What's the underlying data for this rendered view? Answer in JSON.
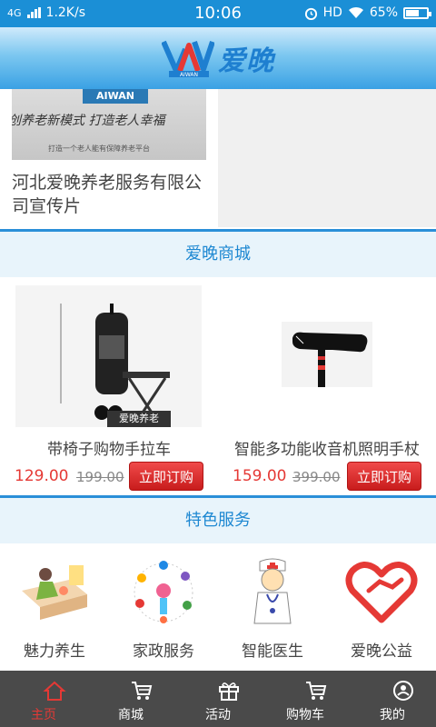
{
  "status_bar": {
    "network": "4G",
    "speed": "1.2K/s",
    "time": "10:06",
    "hd": "HD",
    "battery_percent": "65%",
    "battery_level": 0.65
  },
  "header": {
    "logo_sub": "AIWAN",
    "brand": "爱晚"
  },
  "video": {
    "badge": "AIWAN",
    "slogan": "创养老新模式 打造老人幸福",
    "subline": "打造一个老人能有保障养老平台",
    "title": "河北爱晚养老服务有限公司宣传片"
  },
  "shop": {
    "section_title": "爱晚商城",
    "products": [
      {
        "name": "带椅子购物手拉车",
        "price": "129.00",
        "old_price": "199.00",
        "buy_label": "立即订购",
        "watermark": "爱晚养老"
      },
      {
        "name": "智能多功能收音机照明手杖",
        "price": "159.00",
        "old_price": "399.00",
        "buy_label": "立即订购"
      }
    ]
  },
  "services": {
    "section_title": "特色服务",
    "items": [
      {
        "label": "魅力养生",
        "icon": "wellness-icon"
      },
      {
        "label": "家政服务",
        "icon": "housekeeping-icon"
      },
      {
        "label": "智能医生",
        "icon": "doctor-icon"
      },
      {
        "label": "爱晚公益",
        "icon": "charity-heart-icon"
      }
    ]
  },
  "tabbar": {
    "items": [
      {
        "label": "主页",
        "icon": "home-icon"
      },
      {
        "label": "商城",
        "icon": "cart-icon"
      },
      {
        "label": "活动",
        "icon": "gift-icon"
      },
      {
        "label": "购物车",
        "icon": "cart-icon"
      },
      {
        "label": "我的",
        "icon": "user-icon"
      }
    ],
    "active_color": "#e53935"
  },
  "colors": {
    "accent": "#1e88d2",
    "price": "#e53935",
    "tabbar_bg": "#4a4a4a"
  }
}
